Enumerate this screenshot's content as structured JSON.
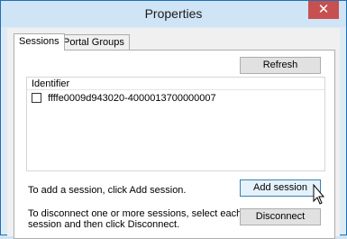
{
  "window": {
    "title": "Properties",
    "close_glyph": "✕"
  },
  "tabs": [
    {
      "label": "Sessions",
      "active": true
    },
    {
      "label": "Portal Groups",
      "active": false
    }
  ],
  "refresh_label": "Refresh",
  "list": {
    "header": "Identifier",
    "rows": [
      {
        "checked": false,
        "identifier": "ffffe0009d943020-4000013700000007"
      }
    ]
  },
  "add_text": "To add a session, click Add session.",
  "add_button": "Add session",
  "disconnect_text_line1": "To disconnect one or more sessions, select each",
  "disconnect_text_line2": "session and then click Disconnect.",
  "disconnect_button": "Disconnect",
  "colors": {
    "accent": "#1f6fb5",
    "close": "#c75050",
    "hover_button": "#e5f1fb"
  }
}
